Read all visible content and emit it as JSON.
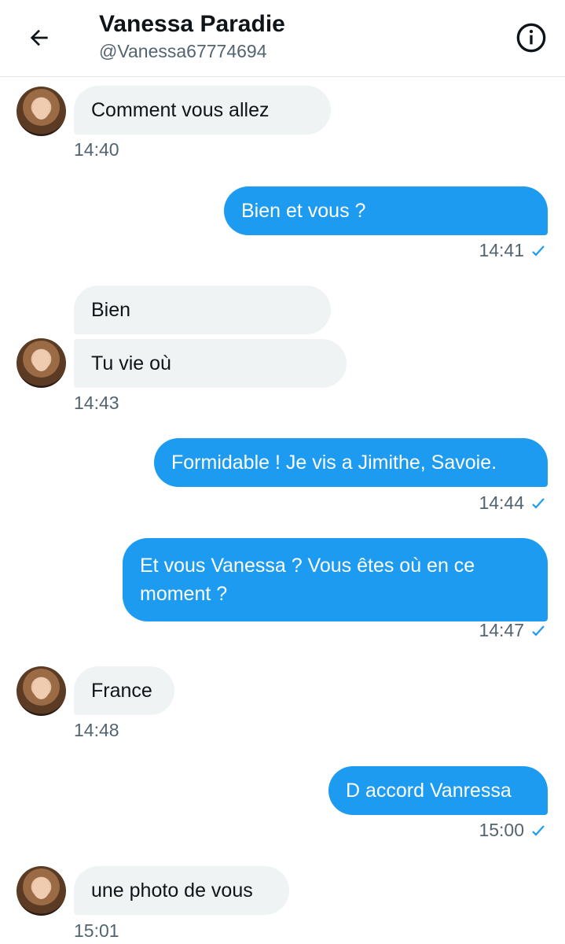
{
  "header": {
    "name": "Vanessa Paradie",
    "handle": "@Vanessa67774694",
    "back_icon": "arrow-left-icon",
    "info_icon": "info-circle-icon"
  },
  "colors": {
    "accent": "#1d9bf0",
    "incoming_bubble": "#eff3f4",
    "muted_text": "#536471"
  },
  "messages": [
    {
      "direction": "in",
      "text": "Comment vous allez",
      "time": "14:40"
    },
    {
      "direction": "out",
      "text": "Bien et vous ?",
      "time": "14:41"
    },
    {
      "direction": "in",
      "text": "Bien"
    },
    {
      "direction": "in",
      "text": "Tu vie où",
      "time": "14:43"
    },
    {
      "direction": "out",
      "text": "Formidable ! Je vis a Jimithe, Savoie.",
      "time": "14:44"
    },
    {
      "direction": "out",
      "text": "Et vous Vanessa ? Vous êtes où en ce",
      "text_line2": "moment ?",
      "time": "14:47"
    },
    {
      "direction": "in",
      "text": "France",
      "time": "14:48"
    },
    {
      "direction": "out",
      "text": "D accord Vanressa",
      "time": "15:00"
    },
    {
      "direction": "in",
      "text": "une photo de vous",
      "time": "15:01"
    }
  ]
}
